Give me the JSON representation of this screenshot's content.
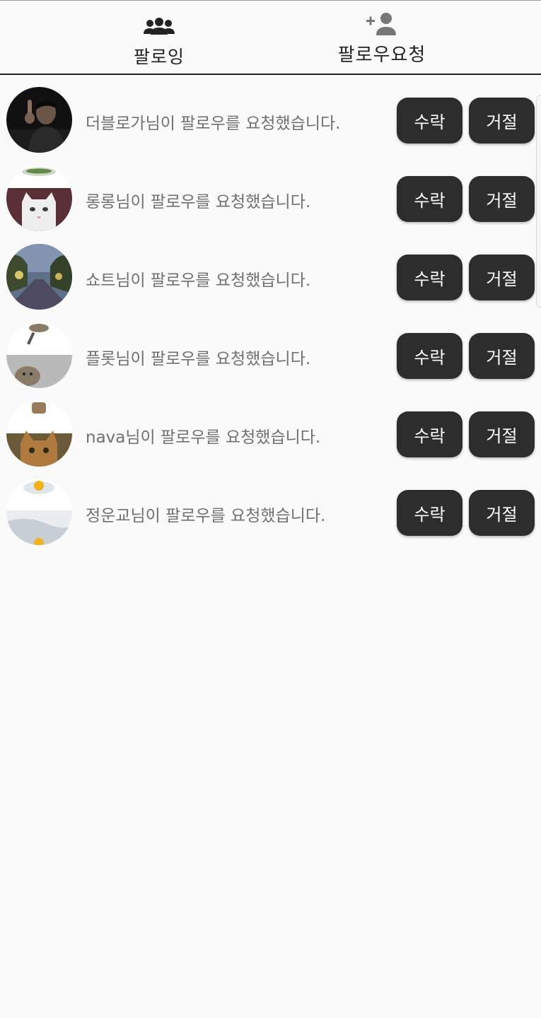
{
  "tabs": [
    {
      "label": "팔로잉",
      "icon": "group-icon",
      "active": false
    },
    {
      "label": "팔로우요청",
      "icon": "person-add-icon",
      "active": true
    }
  ],
  "requests": [
    {
      "message": "더블로가님이 팔로우를 요청했습니다.",
      "accept_label": "수락",
      "reject_label": "거절",
      "avatar": "man-pointing-photo"
    },
    {
      "message": "롱롱님이 팔로우를 요청했습니다.",
      "accept_label": "수락",
      "reject_label": "거절",
      "avatar": "white-cat-photo"
    },
    {
      "message": "쇼트님이 팔로우를 요청했습니다.",
      "accept_label": "수락",
      "reject_label": "거절",
      "avatar": "night-road-photo"
    },
    {
      "message": "플롯님이 팔로우를 요청했습니다.",
      "accept_label": "수락",
      "reject_label": "거절",
      "avatar": "cat-with-pan-photo"
    },
    {
      "message": "nava님이 팔로우를 요청했습니다.",
      "accept_label": "수락",
      "reject_label": "거절",
      "avatar": "tabby-cat-photo"
    },
    {
      "message": "정운교님이 팔로우를 요청했습니다.",
      "accept_label": "수락",
      "reject_label": "거절",
      "avatar": "egg-photo"
    }
  ],
  "colors": {
    "button_bg": "#2d2d2d",
    "button_text": "#ffffff",
    "message_text": "#707070",
    "tab_text": "#222222",
    "background": "#fafafa"
  }
}
